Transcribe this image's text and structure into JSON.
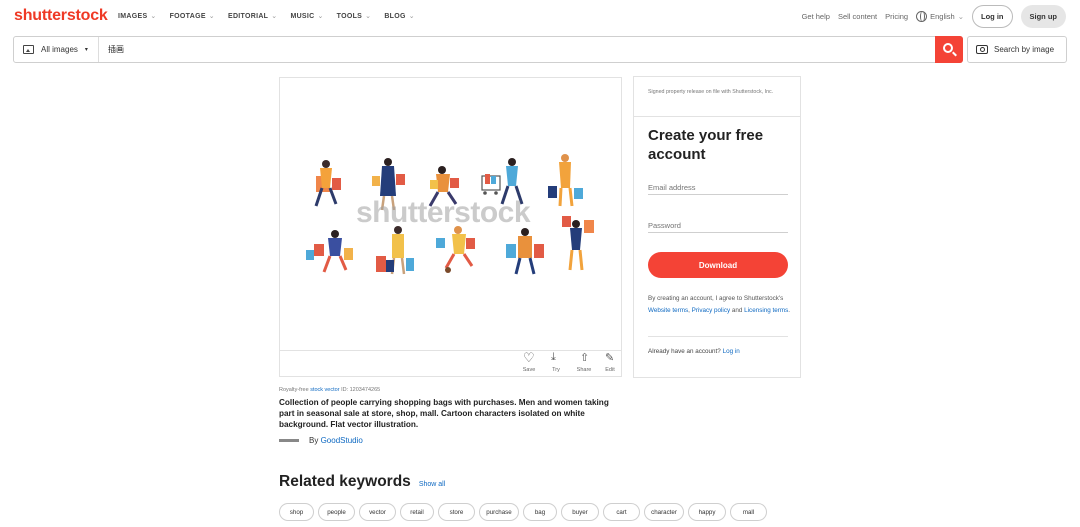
{
  "brand": {
    "logo": "shutterstock",
    "accent": "#ef3925",
    "link": "#0e69c2"
  },
  "nav": {
    "items": [
      {
        "label": "IMAGES",
        "active": true
      },
      {
        "label": "FOOTAGE"
      },
      {
        "label": "EDITORIAL"
      },
      {
        "label": "MUSIC"
      },
      {
        "label": "TOOLS"
      },
      {
        "label": "BLOG"
      }
    ],
    "get_help": "Get help",
    "sell_content": "Sell content",
    "pricing": "Pricing",
    "language": "English",
    "login": "Log in",
    "signup": "Sign up"
  },
  "search": {
    "type_label": "All images",
    "value": "插画",
    "search_by_image": "Search by image"
  },
  "image": {
    "watermark": "shutterstock",
    "actions": [
      "Save",
      "Try",
      "Share",
      "Edit"
    ]
  },
  "meta": {
    "royalty_prefix": "Royalty-free",
    "royalty_link": "stock vector",
    "id_text": "ID: 1203474265",
    "description": "Collection of people carrying shopping bags with purchases. Men and women taking part in seasonal sale at store, shop, mall. Cartoon characters isolated on white background. Flat vector illustration.",
    "by": "By",
    "contributor": "GoodStudio"
  },
  "account": {
    "release_note": "Signed property release on file with Shutterstock, Inc.",
    "title": "Create your free account",
    "email_placeholder": "Email address",
    "password_placeholder": "Password",
    "download": "Download",
    "terms_1": "By creating an account, I agree to Shutterstock's",
    "website_terms": "Website terms",
    "privacy": "Privacy policy",
    "and": "and",
    "licensing": "Licensing terms",
    "already": "Already have an account?",
    "login": "Log in"
  },
  "related": {
    "title": "Related keywords",
    "show_all": "Show all",
    "keywords": [
      "shop",
      "people",
      "vector",
      "retail",
      "store",
      "purchase",
      "bag",
      "buyer",
      "cart",
      "character",
      "happy",
      "mall"
    ]
  }
}
